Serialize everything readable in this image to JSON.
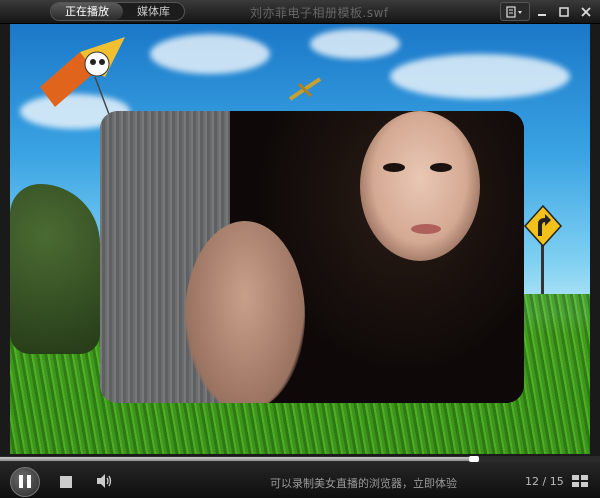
{
  "titlebar": {
    "tabs": [
      {
        "label": "正在播放",
        "active": true
      },
      {
        "label": "媒体库",
        "active": false
      }
    ],
    "window_title": "刘亦菲电子相册模板.swf",
    "controls": {
      "menu_icon": "view-menu-icon",
      "minimize_icon": "minimize-icon",
      "maximize_icon": "maximize-icon",
      "close_icon": "close-icon"
    }
  },
  "player": {
    "progress_fraction": 0.79,
    "promo_text": "可以录制美女直播的浏览器，立即体验",
    "counter": "12 / 15",
    "icons": {
      "play_pause": "pause-icon",
      "stop": "stop-icon",
      "volume": "volume-icon",
      "playlist": "grid-icon"
    }
  },
  "colors": {
    "titlebar": "#1c1c1c",
    "progress_fill": "#bcbcbc",
    "promo_text": "#9a9a9a"
  }
}
